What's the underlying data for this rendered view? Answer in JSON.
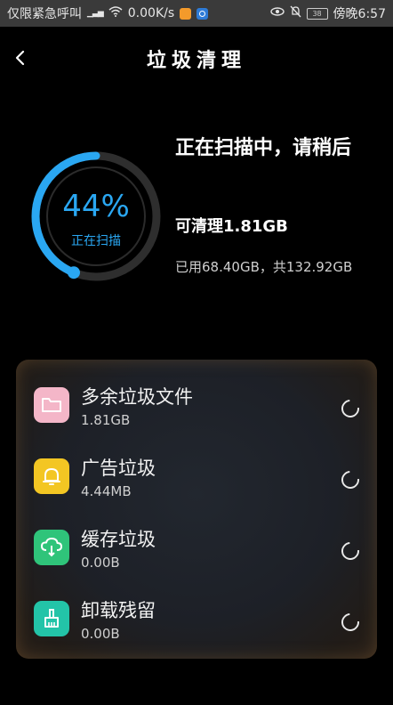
{
  "status_bar": {
    "carrier": "仅限紧急呼叫",
    "network_speed": "0.00K/s",
    "battery": "38",
    "time": "傍晚6:57"
  },
  "header": {
    "title": "垃圾清理"
  },
  "scan": {
    "progress_percent": 44,
    "percent_label": "44%",
    "status_label": "正在扫描",
    "heading": "正在扫描中，请稍后",
    "cleanable": "可清理1.81GB",
    "usage": "已用68.40GB，共132.92GB"
  },
  "colors": {
    "accent": "#2aa7f2",
    "ring_track": "#2e2e2e",
    "icon_redundant": "#f4b6c8",
    "icon_ads": "#f3c623",
    "icon_cache": "#2fc47a",
    "icon_uninstall": "#23c4a8"
  },
  "items": [
    {
      "name": "多余垃圾文件",
      "size": "1.81GB",
      "icon": "folder-icon"
    },
    {
      "name": "广告垃圾",
      "size": "4.44MB",
      "icon": "bell-icon"
    },
    {
      "name": "缓存垃圾",
      "size": "0.00B",
      "icon": "cloud-download-icon"
    },
    {
      "name": "卸载残留",
      "size": "0.00B",
      "icon": "broom-icon"
    }
  ]
}
